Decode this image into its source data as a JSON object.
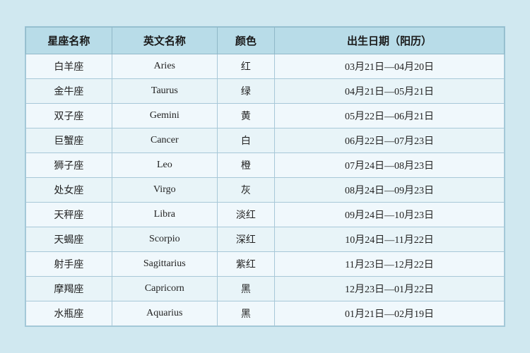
{
  "table": {
    "headers": {
      "cn_name": "星座名称",
      "en_name": "英文名称",
      "color": "颜色",
      "date": "出生日期（阳历）"
    },
    "rows": [
      {
        "cn": "白羊座",
        "en": "Aries",
        "color": "红",
        "date": "03月21日—04月20日"
      },
      {
        "cn": "金牛座",
        "en": "Taurus",
        "color": "绿",
        "date": "04月21日—05月21日"
      },
      {
        "cn": "双子座",
        "en": "Gemini",
        "color": "黄",
        "date": "05月22日—06月21日"
      },
      {
        "cn": "巨蟹座",
        "en": "Cancer",
        "color": "白",
        "date": "06月22日—07月23日"
      },
      {
        "cn": "狮子座",
        "en": "Leo",
        "color": "橙",
        "date": "07月24日—08月23日"
      },
      {
        "cn": "处女座",
        "en": "Virgo",
        "color": "灰",
        "date": "08月24日—09月23日"
      },
      {
        "cn": "天秤座",
        "en": "Libra",
        "color": "淡红",
        "date": "09月24日—10月23日"
      },
      {
        "cn": "天蝎座",
        "en": "Scorpio",
        "color": "深红",
        "date": "10月24日—11月22日"
      },
      {
        "cn": "射手座",
        "en": "Sagittarius",
        "color": "紫红",
        "date": "11月23日—12月22日"
      },
      {
        "cn": "摩羯座",
        "en": "Capricorn",
        "color": "黑",
        "date": "12月23日—01月22日"
      },
      {
        "cn": "水瓶座",
        "en": "Aquarius",
        "color": "黑",
        "date": "01月21日—02月19日"
      }
    ]
  }
}
